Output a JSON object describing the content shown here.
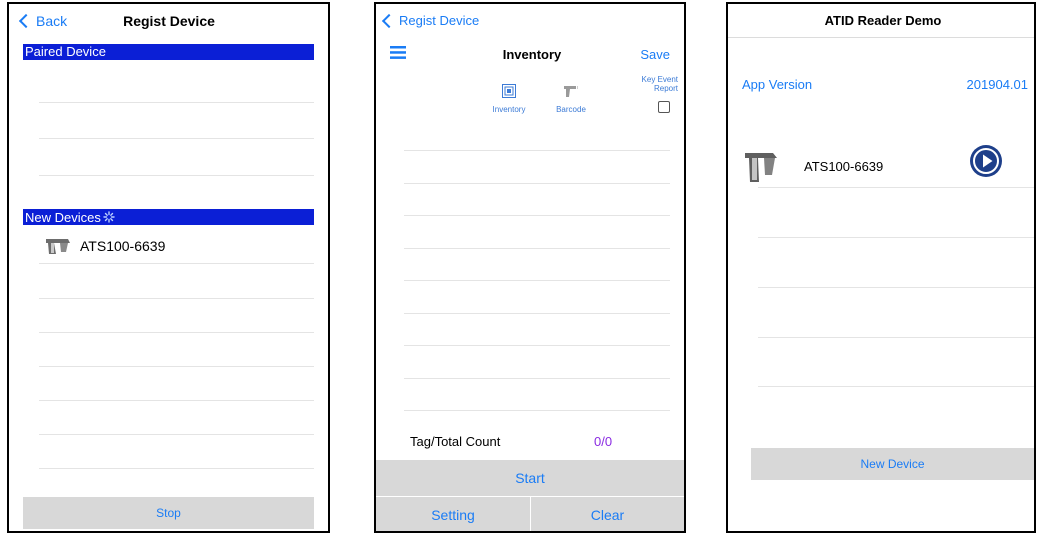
{
  "screen1": {
    "back_label": "Back",
    "title": "Regist Device",
    "paired_header": "Paired Device",
    "new_header": "New Devices",
    "device_name": "ATS100-6639",
    "stop_label": "Stop"
  },
  "screen2": {
    "back_label": "Regist Device",
    "title": "Inventory",
    "save_label": "Save",
    "tab_inventory": "Inventory",
    "tab_barcode": "Barcode",
    "key_event_label_1": "Key Event",
    "key_event_label_2": "Report",
    "count_label": "Tag/Total Count",
    "count_value": "0/0",
    "start_label": "Start",
    "setting_label": "Setting",
    "clear_label": "Clear"
  },
  "screen3": {
    "title": "ATID Reader Demo",
    "app_version_label": "App Version",
    "app_version_value": "201904.01",
    "device_name": "ATS100-6639",
    "new_device_label": "New Device"
  },
  "colors": {
    "accent": "#1a7cf5",
    "section_bar": "#0b1fd6",
    "count_value": "#8a2be2",
    "play_button": "#1e3f8a"
  },
  "icons": [
    "chevron-left-icon",
    "hamburger-menu-icon",
    "rfid-inventory-icon",
    "barcode-scanner-icon",
    "checkbox-icon",
    "reader-device-icon",
    "play-circle-icon",
    "loading-spinner-icon"
  ]
}
